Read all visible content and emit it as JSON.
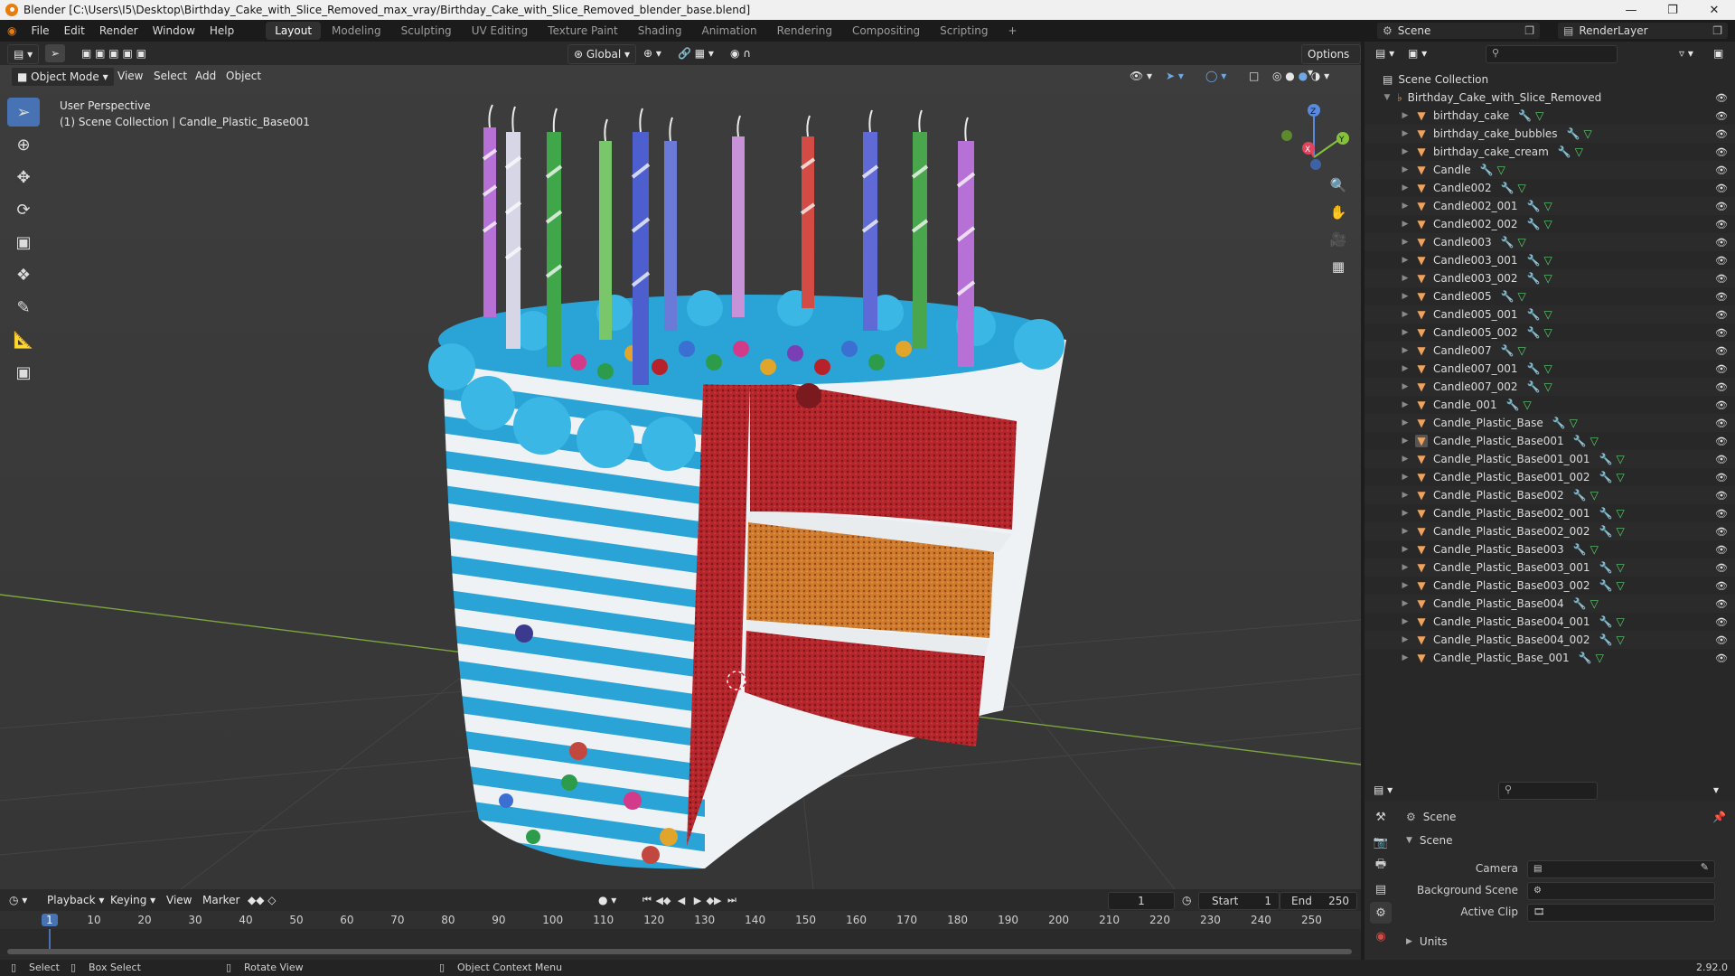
{
  "window": {
    "title": "Blender [C:\\Users\\I5\\Desktop\\Birthday_Cake_with_Slice_Removed_max_vray/Birthday_Cake_with_Slice_Removed_blender_base.blend]"
  },
  "menu": [
    "File",
    "Edit",
    "Render",
    "Window",
    "Help"
  ],
  "workspaces": [
    "Layout",
    "Modeling",
    "Sculpting",
    "UV Editing",
    "Texture Paint",
    "Shading",
    "Animation",
    "Rendering",
    "Compositing",
    "Scripting"
  ],
  "active_workspace": "Layout",
  "scene_name": "Scene",
  "render_layer": "RenderLayer",
  "viewport": {
    "mode": "Object Mode",
    "menus": [
      "View",
      "Select",
      "Add",
      "Object"
    ],
    "transform_orientation": "Global",
    "options_label": "Options",
    "overlay_line1": "User Perspective",
    "overlay_line2": "(1) Scene Collection | Candle_Plastic_Base001",
    "gizmo": {
      "x": "X",
      "y": "Y",
      "z": "Z"
    }
  },
  "outliner": {
    "root": "Scene Collection",
    "collection": "Birthday_Cake_with_Slice_Removed",
    "selected": "Candle_Plastic_Base001",
    "objects": [
      "birthday_cake",
      "birthday_cake_bubbles",
      "birthday_cake_cream",
      "Candle",
      "Candle002",
      "Candle002_001",
      "Candle002_002",
      "Candle003",
      "Candle003_001",
      "Candle003_002",
      "Candle005",
      "Candle005_001",
      "Candle005_002",
      "Candle007",
      "Candle007_001",
      "Candle007_002",
      "Candle_001",
      "Candle_Plastic_Base",
      "Candle_Plastic_Base001",
      "Candle_Plastic_Base001_001",
      "Candle_Plastic_Base001_002",
      "Candle_Plastic_Base002",
      "Candle_Plastic_Base002_001",
      "Candle_Plastic_Base002_002",
      "Candle_Plastic_Base003",
      "Candle_Plastic_Base003_001",
      "Candle_Plastic_Base003_002",
      "Candle_Plastic_Base004",
      "Candle_Plastic_Base004_001",
      "Candle_Plastic_Base004_002",
      "Candle_Plastic_Base_001"
    ]
  },
  "properties": {
    "context": "Scene",
    "panel": "Scene",
    "camera_label": "Camera",
    "background_scene_label": "Background Scene",
    "active_clip_label": "Active Clip",
    "units_label": "Units"
  },
  "timeline": {
    "menus": [
      "Playback",
      "Keying",
      "View",
      "Marker"
    ],
    "current_frame": "1",
    "start_label": "Start",
    "start": "1",
    "end_label": "End",
    "end": "250",
    "ticks": [
      "1",
      "10",
      "20",
      "30",
      "40",
      "50",
      "60",
      "70",
      "80",
      "90",
      "100",
      "110",
      "120",
      "130",
      "140",
      "150",
      "160",
      "170",
      "180",
      "190",
      "200",
      "210",
      "220",
      "230",
      "240",
      "250"
    ]
  },
  "status": {
    "select": "Select",
    "box_select": "Box Select",
    "rotate_view": "Rotate View",
    "context_menu": "Object Context Menu",
    "version": "2.92.0"
  },
  "colors": {
    "accent": "#4772b3",
    "object_icon": "#f0a35c",
    "modifier": "#6ea8e6",
    "mesh": "#5bd06a",
    "cake_blue": "#2aa3d6",
    "sponge_red": "#b3262c",
    "sponge_orange": "#d07a2e"
  }
}
